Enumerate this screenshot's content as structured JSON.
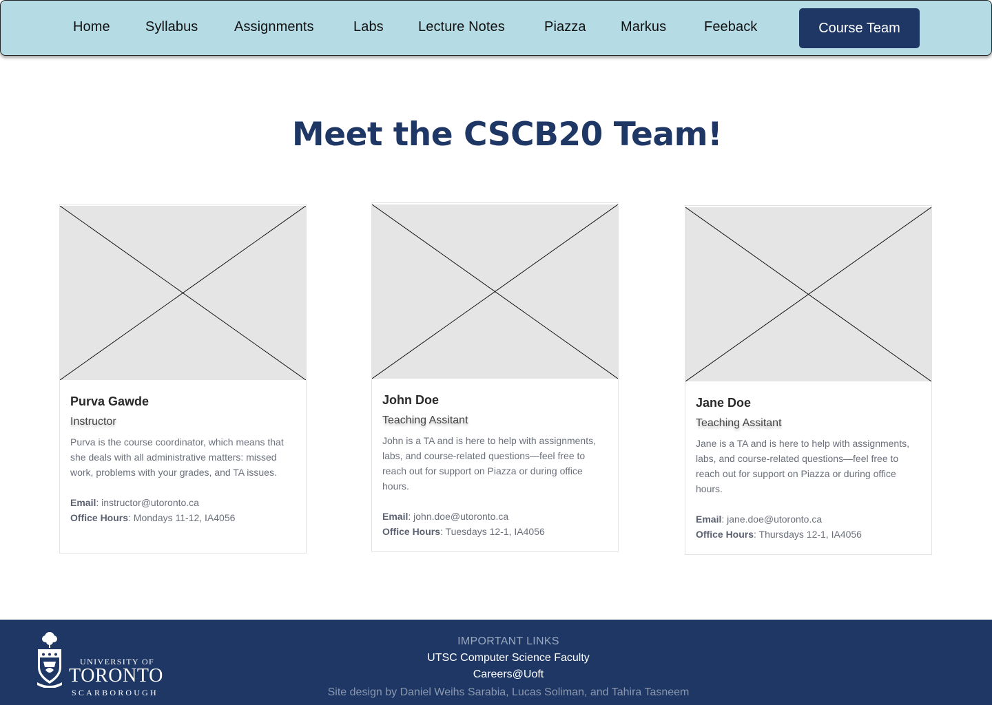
{
  "nav": {
    "items": [
      {
        "label": "Home"
      },
      {
        "label": "Syllabus"
      },
      {
        "label": "Assignments"
      },
      {
        "label": "Labs"
      },
      {
        "label": "Lecture Notes"
      },
      {
        "label": "Piazza"
      },
      {
        "label": "Markus"
      },
      {
        "label": "Feeback"
      }
    ],
    "active_label": "Course Team",
    "colors": {
      "bar": "#b5dbe5",
      "active": "#1e3765"
    }
  },
  "main": {
    "title": "Meet the CSCB20 Team!",
    "team": [
      {
        "name": "Purva Gawde",
        "role": "Instructor",
        "description": "Purva is the course coordinator, which means that she deals with all administrative matters: missed work, problems with your grades, and TA issues.",
        "email_label": "Email",
        "email": ": instructor@utoronto.ca",
        "hours_label": "Office Hours",
        "hours": ": Mondays 11-12, IA4056",
        "photo_icon": "image-placeholder-icon"
      },
      {
        "name": "John Doe",
        "role": "Teaching Assitant",
        "description": "John is a TA and is here to help with assignments, labs, and course-related questions—feel free to reach out for support on Piazza or during office hours.",
        "email_label": "Email",
        "email": ": john.doe@utoronto.ca",
        "hours_label": "Office Hours",
        "hours": ": Tuesdays 12-1, IA4056",
        "photo_icon": "image-placeholder-icon"
      },
      {
        "name": "Jane Doe",
        "role": "Teaching Assitant",
        "description": "Jane is a TA and is here to help with assignments, labs, and course-related questions—feel free to reach out for support on Piazza or during office hours.",
        "email_label": "Email",
        "email": ": jane.doe@utoronto.ca",
        "hours_label": "Office Hours",
        "hours": ": Thursdays 12-1, IA4056",
        "photo_icon": "image-placeholder-icon"
      }
    ]
  },
  "footer": {
    "logo": {
      "line1": "UNIVERSITY OF",
      "line2": "TORONTO",
      "line3": "SCARBOROUGH",
      "icon": "uoft-crest-icon"
    },
    "heading": "IMPORTANT LINKS",
    "links": [
      {
        "label": "UTSC Computer Science Faculty"
      },
      {
        "label": "Careers@Uoft"
      }
    ],
    "credit": "Site design by Daniel Weihs Sarabia, Lucas Soliman, and Tahira Tasneem",
    "colors": {
      "background": "#1e3765"
    }
  }
}
